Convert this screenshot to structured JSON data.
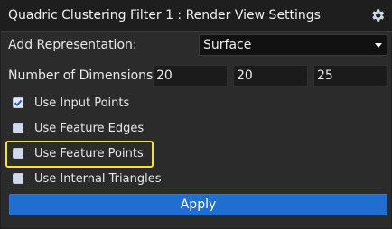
{
  "window": {
    "title": "Quadric Clustering Filter 1 : Render View Settings",
    "gear_icon": "gear-icon"
  },
  "representation": {
    "label": "Add Representation:",
    "value": "Surface",
    "icon": "chevron-down-icon"
  },
  "dimensions": {
    "label": "Number of Dimensions :",
    "values": [
      "20",
      "20",
      "25"
    ]
  },
  "options": [
    {
      "label": "Use Input Points",
      "checked": true
    },
    {
      "label": "Use Feature Edges",
      "checked": false
    },
    {
      "label": "Use Feature Points",
      "checked": false
    },
    {
      "label": "Use Internal Triangles",
      "checked": false
    }
  ],
  "apply": {
    "label": "Apply",
    "color": "#1f6fd0"
  },
  "colors": {
    "highlight": "#f5e51a",
    "title_bar": "#1e1e1e",
    "panel": "#2b2b2b"
  }
}
